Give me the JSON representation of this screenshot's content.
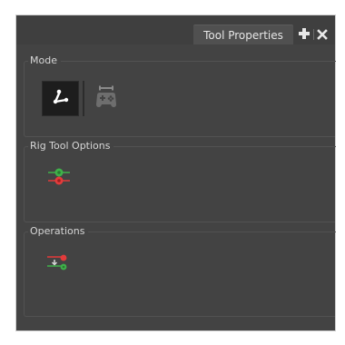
{
  "tab": {
    "title": "Tool Properties"
  },
  "sections": {
    "mode": {
      "label": "Mode"
    },
    "rig_tool_options": {
      "label": "Rig Tool Options"
    },
    "operations": {
      "label": "Operations"
    }
  },
  "icons": {
    "add": "plus-icon",
    "close": "close-icon",
    "rig_mode": "rig-mode-icon",
    "game_mode": "gamepad-icon",
    "rig_option": "rig-option-icon",
    "operation": "operation-icon"
  },
  "colors": {
    "panel_bg": "#434343",
    "active_mode_bg": "#1d1d1d",
    "green": "#3fb14a",
    "red": "#e33b3b"
  }
}
